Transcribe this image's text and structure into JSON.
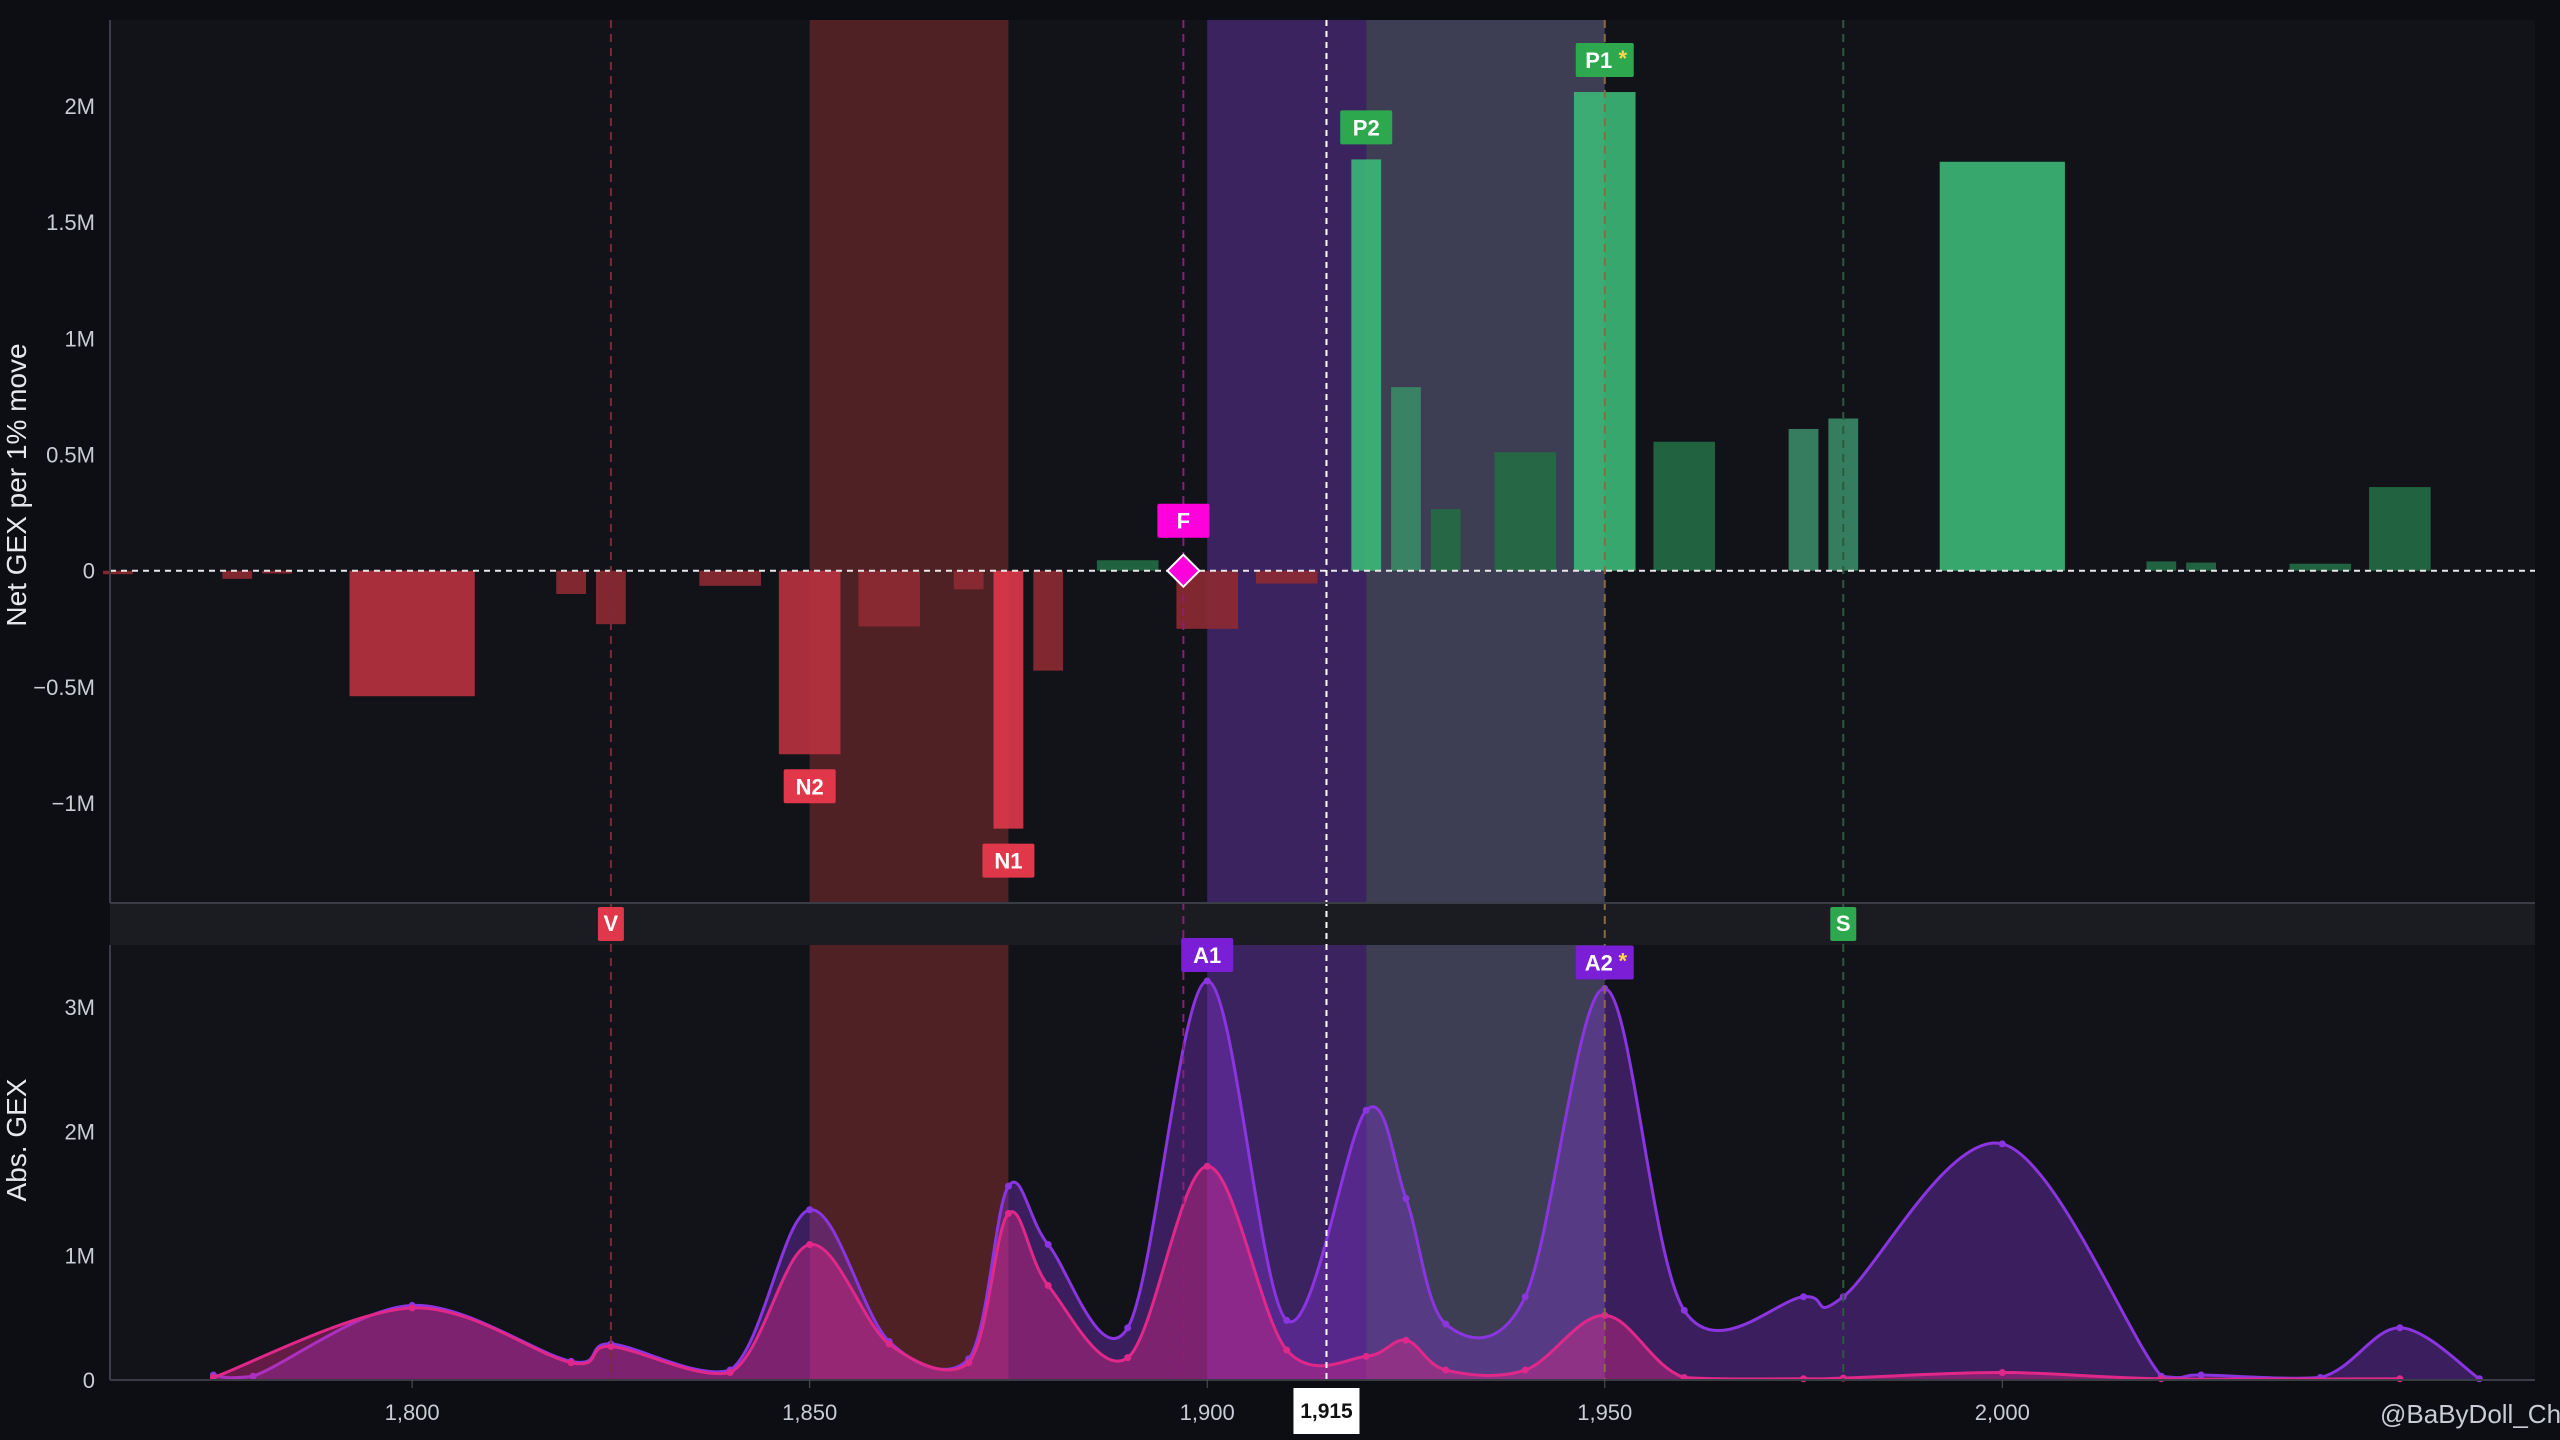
{
  "chart_data": [
    {
      "type": "bar",
      "ylabel": "Net GEX per 1% move",
      "y_tick_labels": [
        "2M",
        "1.5M",
        "1M",
        "0.5M",
        "0",
        "−0.5M",
        "−1M"
      ],
      "y_ticks": [
        2000000,
        1500000,
        1000000,
        500000,
        0,
        -500000,
        -1000000
      ],
      "ylim": [
        -1430000,
        2370000
      ],
      "xlim": [
        1762,
        2067
      ],
      "grid": false,
      "bars": [
        {
          "x": 1763,
          "width": 4,
          "value": -15000
        },
        {
          "x": 1778,
          "width": 4,
          "value": -35000
        },
        {
          "x": 1783,
          "width": 4,
          "value": -12000
        },
        {
          "x": 1800,
          "width": 16,
          "value": -540000
        },
        {
          "x": 1820,
          "width": 4,
          "value": -100000
        },
        {
          "x": 1825,
          "width": 4,
          "value": -230000
        },
        {
          "x": 1840,
          "width": 8,
          "value": -65000
        },
        {
          "x": 1850,
          "width": 8,
          "value": -790000
        },
        {
          "x": 1860,
          "width": 8,
          "value": -240000
        },
        {
          "x": 1870,
          "width": 4,
          "value": -80000
        },
        {
          "x": 1875,
          "width": 4,
          "value": -1110000
        },
        {
          "x": 1880,
          "width": 4,
          "value": -430000
        },
        {
          "x": 1890,
          "width": 8,
          "value": 45000
        },
        {
          "x": 1900,
          "width": 8,
          "value": -250000
        },
        {
          "x": 1910,
          "width": 8,
          "value": -55000
        },
        {
          "x": 1920,
          "width": 4,
          "value": 1770000
        },
        {
          "x": 1925,
          "width": 4,
          "value": 790000
        },
        {
          "x": 1930,
          "width": 4,
          "value": 265000
        },
        {
          "x": 1940,
          "width": 8,
          "value": 510000
        },
        {
          "x": 1950,
          "width": 8,
          "value": 2060000
        },
        {
          "x": 1960,
          "width": 8,
          "value": 555000
        },
        {
          "x": 1975,
          "width": 4,
          "value": 610000
        },
        {
          "x": 1980,
          "width": 4,
          "value": 655000
        },
        {
          "x": 2000,
          "width": 16,
          "value": 1760000
        },
        {
          "x": 2020,
          "width": 4,
          "value": 40000
        },
        {
          "x": 2025,
          "width": 4,
          "value": 35000
        },
        {
          "x": 2040,
          "width": 8,
          "value": 30000
        },
        {
          "x": 2050,
          "width": 8,
          "value": 360000
        }
      ],
      "markers": [
        {
          "label": "N2",
          "x": 1850,
          "value": -790000,
          "color": "#e0384a"
        },
        {
          "label": "N1",
          "x": 1875,
          "value": -1110000,
          "color": "#e0384a"
        },
        {
          "label": "P2",
          "x": 1920,
          "value": 1770000,
          "color": "#2ea84f"
        },
        {
          "label": "P1",
          "star": "*",
          "x": 1950,
          "value": 2060000,
          "color": "#2ea84f"
        },
        {
          "label": "F",
          "x": 1897,
          "value": 0,
          "color": "#ff00dd"
        }
      ]
    },
    {
      "type": "area",
      "ylabel": "Abs. GEX",
      "y_tick_labels": [
        "3M",
        "2M",
        "1M",
        "0"
      ],
      "y_ticks": [
        3000000,
        2000000,
        1000000,
        0
      ],
      "ylim": [
        0,
        3500000
      ],
      "x_tick_labels": [
        "1,800",
        "1,850",
        "1,900",
        "1,950",
        "2,000"
      ],
      "x_ticks": [
        1800,
        1850,
        1900,
        1950,
        2000
      ],
      "series": [
        {
          "color": "#8a35e0",
          "points": [
            [
              1775,
              40000
            ],
            [
              1780,
              30000
            ],
            [
              1800,
              600000
            ],
            [
              1820,
              150000
            ],
            [
              1825,
              290000
            ],
            [
              1840,
              80000
            ],
            [
              1850,
              1370000
            ],
            [
              1860,
              310000
            ],
            [
              1870,
              170000
            ],
            [
              1875,
              1560000
            ],
            [
              1880,
              1090000
            ],
            [
              1890,
              420000
            ],
            [
              1900,
              3210000
            ],
            [
              1910,
              480000
            ],
            [
              1920,
              2170000
            ],
            [
              1925,
              1460000
            ],
            [
              1930,
              450000
            ],
            [
              1940,
              670000
            ],
            [
              1950,
              3150000
            ],
            [
              1960,
              560000
            ],
            [
              1975,
              670000
            ],
            [
              1980,
              670000
            ],
            [
              2000,
              1900000
            ],
            [
              2020,
              30000
            ],
            [
              2025,
              40000
            ],
            [
              2040,
              20000
            ],
            [
              2050,
              420000
            ],
            [
              2060,
              10000
            ]
          ]
        },
        {
          "color": "#e0288a",
          "points": [
            [
              1775,
              20000
            ],
            [
              1800,
              580000
            ],
            [
              1820,
              140000
            ],
            [
              1825,
              270000
            ],
            [
              1840,
              60000
            ],
            [
              1850,
              1090000
            ],
            [
              1860,
              290000
            ],
            [
              1870,
              140000
            ],
            [
              1875,
              1340000
            ],
            [
              1880,
              760000
            ],
            [
              1890,
              180000
            ],
            [
              1900,
              1720000
            ],
            [
              1910,
              240000
            ],
            [
              1920,
              190000
            ],
            [
              1925,
              320000
            ],
            [
              1930,
              80000
            ],
            [
              1940,
              80000
            ],
            [
              1950,
              520000
            ],
            [
              1960,
              20000
            ],
            [
              1975,
              10000
            ],
            [
              1980,
              15000
            ],
            [
              2000,
              60000
            ],
            [
              2020,
              10000
            ],
            [
              2050,
              10000
            ]
          ]
        }
      ],
      "markers": [
        {
          "label": "A1",
          "x": 1900,
          "value": 3210000,
          "color": "#7a1fd6"
        },
        {
          "label": "A2",
          "star": "*",
          "x": 1950,
          "value": 3150000,
          "color": "#7a1fd6"
        }
      ]
    }
  ],
  "shared": {
    "zones": [
      {
        "from": 1850,
        "to": 1875,
        "color": "#5a2428",
        "opacity": 0.85
      },
      {
        "from": 1900,
        "to": 1920,
        "color": "#4a2a78",
        "opacity": 0.75
      },
      {
        "from": 1920,
        "to": 1950,
        "color": "#6a6a90",
        "opacity": 0.5
      }
    ],
    "vlines": [
      {
        "x": 1825,
        "color": "#7a2c34",
        "label": "V",
        "label_color": "#e0384a"
      },
      {
        "x": 1980,
        "color": "#2a5a3a",
        "label": "S",
        "label_color": "#2ea84f"
      },
      {
        "x": 1897,
        "color": "#8a1c7a",
        "label": ""
      },
      {
        "x": 1950,
        "color": "#8a6a40",
        "label": ""
      }
    ],
    "spot": {
      "x": 1915,
      "label": "1,915"
    },
    "watermark": "@BaByDoll_Ch",
    "colors": {
      "neg_dark": "#8e2a33",
      "neg": "#e0384a",
      "pos_dark": "#236b45",
      "pos_mid": "#3a8a66",
      "pos": "#3cb878",
      "background": "#0c0e13",
      "panel": "#111318"
    }
  }
}
